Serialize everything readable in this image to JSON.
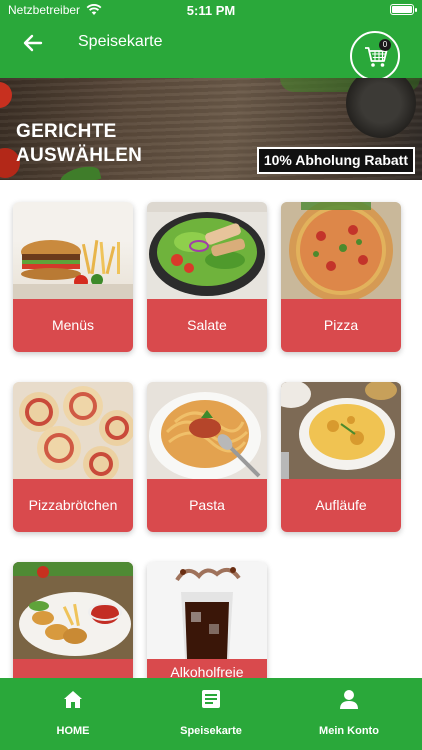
{
  "status": {
    "carrier": "Netzbetreiber",
    "time": "5:11 PM"
  },
  "header": {
    "title": "Speisekarte",
    "cart_count": "0"
  },
  "banner": {
    "title_line1": "GERICHTE",
    "title_line2": "AUSWÄHLEN",
    "promo": "10% Abholung Rabatt"
  },
  "categories": [
    {
      "label": "Menüs"
    },
    {
      "label": "Salate"
    },
    {
      "label": "Pizza"
    },
    {
      "label": "Pizzabrötchen"
    },
    {
      "label": "Pasta"
    },
    {
      "label": "Aufläufe"
    },
    {
      "label": ""
    },
    {
      "label": "Alkoholfreie"
    }
  ],
  "bottom_nav": [
    {
      "label": "HOME",
      "icon": "home-icon"
    },
    {
      "label": "Speisekarte",
      "icon": "menu-list-icon"
    },
    {
      "label": "Mein Konto",
      "icon": "account-icon"
    }
  ],
  "colors": {
    "primary": "#2aa83a",
    "tile_label": "#d94a4d"
  }
}
